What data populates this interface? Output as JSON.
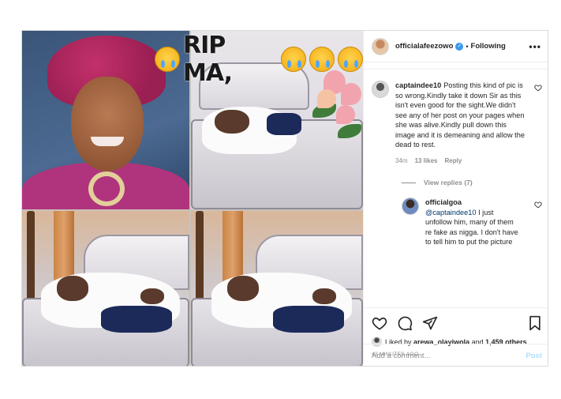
{
  "banner": {
    "text": "RIP MA,"
  },
  "header": {
    "username": "officialafeezowo",
    "verified_mark": "✓",
    "separator": "•",
    "follow_state": "Following",
    "more": "•••"
  },
  "comments": [
    {
      "username": "captaindee10",
      "text": "Posting this kind of pic is so wrong.Kindly take it down Sir as this isn't even good for the sight.We didn't see any of her post on your pages when she was alive.Kindly pull down this image and it is demeaning and allow the dead to rest.",
      "age": "34m",
      "likes": "13 likes",
      "reply": "Reply"
    }
  ],
  "view_replies": "View replies (7)",
  "reply": {
    "username": "officialgoa",
    "mention": "@captaindee10",
    "text": " I just unfollow him, many of them re fake as nigga. I don't have to tell him to put the picture"
  },
  "actions": {
    "like_icon": "heart-icon",
    "comment_icon": "comment-icon",
    "share_icon": "share-icon",
    "save_icon": "bookmark-icon"
  },
  "likes": {
    "prefix": "Liked by",
    "user": "arewa_olayiwola",
    "suffix": "and",
    "others": "1,459 others"
  },
  "timestamp": "43 MINUTES AGO",
  "add_comment": {
    "placeholder": "Add a comment...",
    "post_label": "Post"
  },
  "colors": {
    "link": "#00376b",
    "verified": "#3897f0",
    "post_disabled": "#b2dffc",
    "muted": "#8e8e8e"
  }
}
